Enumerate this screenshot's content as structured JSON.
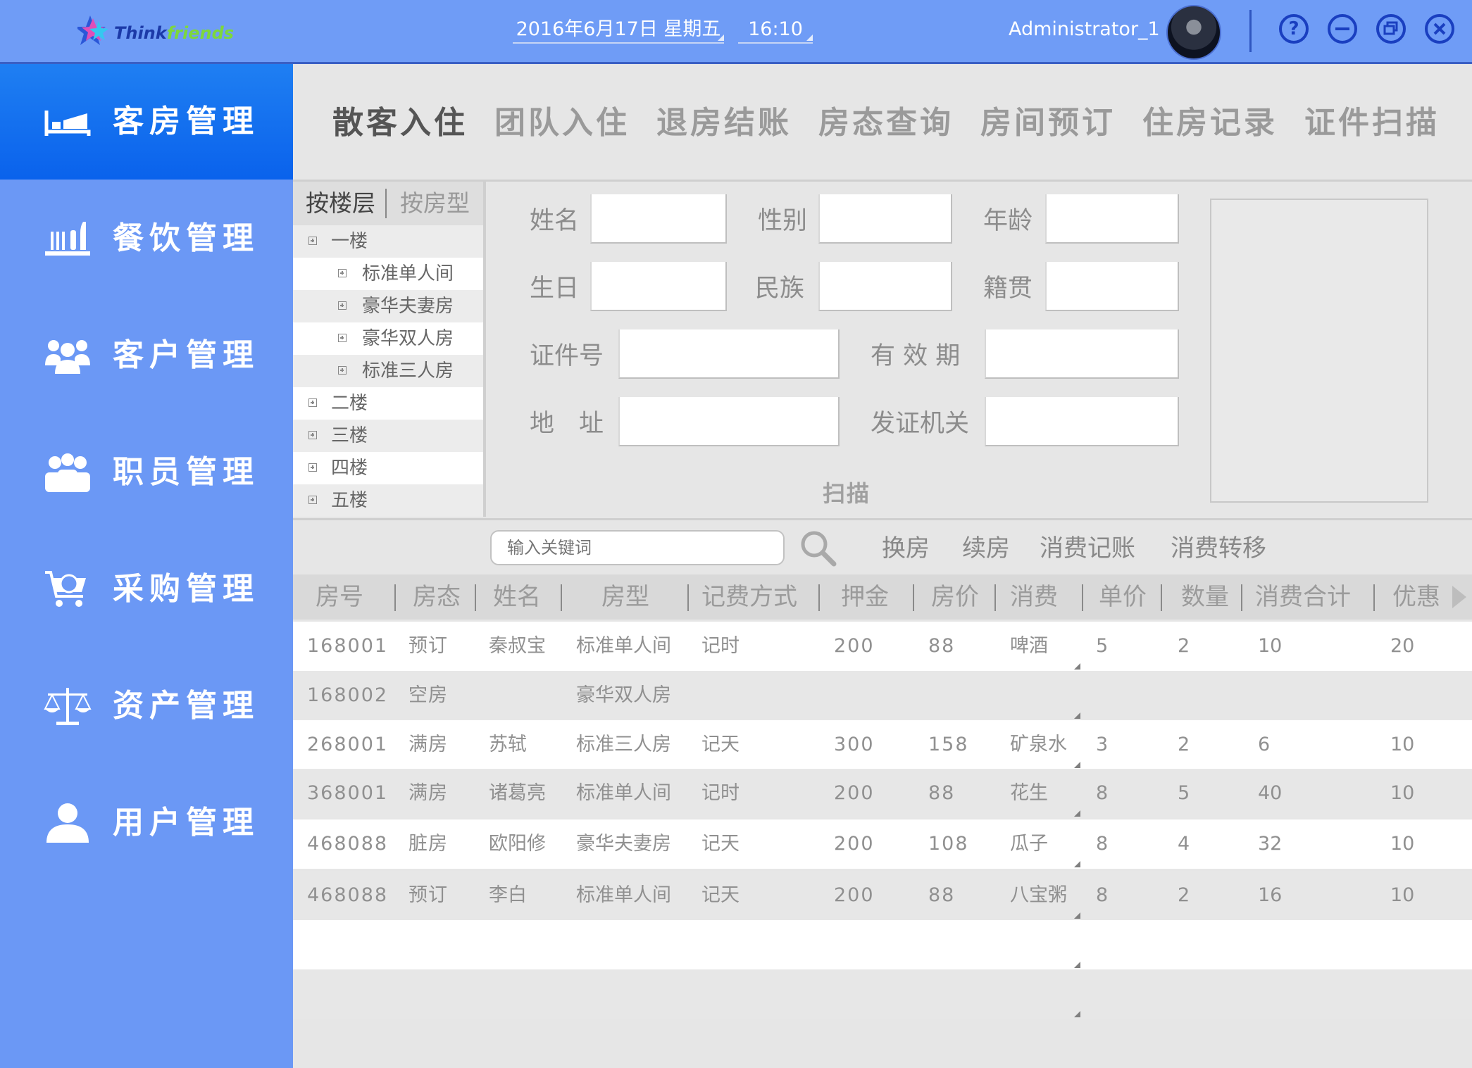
{
  "app": {
    "logo_main": "Think",
    "logo_accent": "friends",
    "date": "2016年6月17日  星期五",
    "time": "16:10",
    "user": "Administrator_1"
  },
  "window_buttons": [
    "help",
    "minimize",
    "restore",
    "close"
  ],
  "sidebar": {
    "items": [
      {
        "label": "客房管理",
        "icon": "bed-icon",
        "active": true
      },
      {
        "label": "餐饮管理",
        "icon": "dining-icon",
        "active": false
      },
      {
        "label": "客户管理",
        "icon": "customers-icon",
        "active": false
      },
      {
        "label": "职员管理",
        "icon": "staff-icon",
        "active": false
      },
      {
        "label": "采购管理",
        "icon": "shopping-cart-icon",
        "active": false
      },
      {
        "label": "资产管理",
        "icon": "scale-icon",
        "active": false
      },
      {
        "label": "用户管理",
        "icon": "user-icon",
        "active": false
      }
    ]
  },
  "tabs": [
    {
      "label": "散客入住",
      "active": true
    },
    {
      "label": "团队入住",
      "active": false
    },
    {
      "label": "退房结账",
      "active": false
    },
    {
      "label": "房态查询",
      "active": false
    },
    {
      "label": "房间预订",
      "active": false
    },
    {
      "label": "住房记录",
      "active": false
    },
    {
      "label": "证件扫描",
      "active": false
    }
  ],
  "tree": {
    "tab_floor": "按楼层",
    "tab_type": "按房型",
    "rows": [
      {
        "label": "一楼",
        "level": 0
      },
      {
        "label": "标准单人间",
        "level": 1
      },
      {
        "label": "豪华夫妻房",
        "level": 1
      },
      {
        "label": "豪华双人房",
        "level": 1
      },
      {
        "label": "标准三人房",
        "level": 1
      },
      {
        "label": "二楼",
        "level": 0
      },
      {
        "label": "三楼",
        "level": 0
      },
      {
        "label": "四楼",
        "level": 0
      },
      {
        "label": "五楼",
        "level": 0
      }
    ]
  },
  "form": {
    "name_label": "姓名",
    "gender_label": "性别",
    "age_label": "年龄",
    "birthday_label": "生日",
    "ethnicity_label": "民族",
    "hometown_label": "籍贯",
    "id_label": "证件号",
    "validity_label": "有 效 期",
    "address_label": "地　址",
    "authority_label": "发证机关",
    "scan_label": "扫描"
  },
  "search": {
    "placeholder": "输入关键词",
    "actions": [
      "换房",
      "续房",
      "消费记账",
      "消费转移"
    ]
  },
  "table": {
    "headers": [
      "房号",
      "房态",
      "姓名",
      "房型",
      "记费方式",
      "押金",
      "房价",
      "消费",
      "单价",
      "数量",
      "消费合计",
      "优惠"
    ],
    "rows": [
      [
        "168001",
        "预订",
        "秦叔宝",
        "标准单人间",
        "记时",
        "200",
        "88",
        "啤酒",
        "5",
        "2",
        "10",
        "20"
      ],
      [
        "168002",
        "空房",
        "",
        "豪华双人房",
        "",
        "",
        "",
        "",
        "",
        "",
        "",
        ""
      ],
      [
        "268001",
        "满房",
        "苏轼",
        "标准三人房",
        "记天",
        "300",
        "158",
        "矿泉水",
        "3",
        "2",
        "6",
        "10"
      ],
      [
        "368001",
        "满房",
        "诸葛亮",
        "标准单人间",
        "记时",
        "200",
        "88",
        "花生",
        "8",
        "5",
        "40",
        "10"
      ],
      [
        "468088",
        "脏房",
        "欧阳修",
        "豪华夫妻房",
        "记天",
        "200",
        "108",
        "瓜子",
        "8",
        "4",
        "32",
        "10"
      ],
      [
        "468088",
        "预订",
        "李白",
        "标准单人间",
        "记天",
        "200",
        "88",
        "八宝粥",
        "8",
        "2",
        "16",
        "10"
      ],
      [
        "",
        "",
        "",
        "",
        "",
        "",
        "",
        "",
        "",
        "",
        "",
        ""
      ],
      [
        "",
        "",
        "",
        "",
        "",
        "",
        "",
        "",
        "",
        "",
        "",
        ""
      ]
    ]
  },
  "colors": {
    "topbar": "#6f9cf6",
    "sidebar": "#6b98f5",
    "sidebar_active": "#0a62ec",
    "panel": "#e6e6e6"
  }
}
